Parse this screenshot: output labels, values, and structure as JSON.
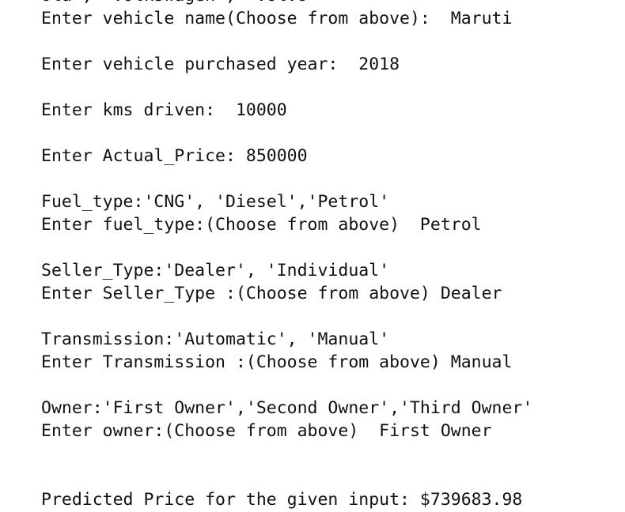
{
  "output": {
    "lines": [
      "Ola', 'Volkswagen', 'Volvo'",
      "Enter vehicle name(Choose from above):  Maruti",
      "",
      "Enter vehicle purchased year:  2018",
      "",
      "Enter kms driven:  10000",
      "",
      "Enter Actual_Price: 850000",
      "",
      "Fuel_type:'CNG', 'Diesel','Petrol'",
      "Enter fuel_type:(Choose from above)  Petrol",
      "",
      "Seller_Type:'Dealer', 'Individual'",
      "Enter Seller_Type :(Choose from above) Dealer",
      "",
      "Transmission:'Automatic', 'Manual'",
      "Enter Transmission :(Choose from above) Manual",
      "",
      "Owner:'First Owner','Second Owner','Third Owner'",
      "Enter owner:(Choose from above)  First Owner",
      "",
      "",
      "Predicted Price for the given input: $739683.98"
    ]
  }
}
